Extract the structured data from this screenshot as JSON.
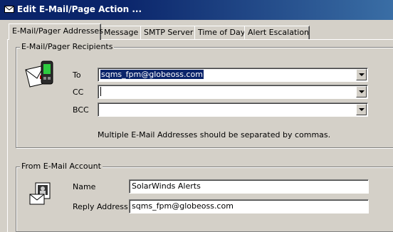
{
  "window": {
    "title": "Edit E-Mail/Page Action ...",
    "background_title": "...     ...     ...   ...     ...    ...     ..."
  },
  "tabs": [
    {
      "label": "E-Mail/Pager Addresses",
      "active": true
    },
    {
      "label": "Message",
      "active": false
    },
    {
      "label": "SMTP Server",
      "active": false
    },
    {
      "label": "Time of Day",
      "active": false
    },
    {
      "label": "Alert Escalation",
      "active": false
    }
  ],
  "recipients": {
    "group_label": "E-Mail/Pager Recipients",
    "to": {
      "label": "To",
      "value": "sqms_fpm@globeoss.com"
    },
    "cc": {
      "label": "CC",
      "value": ""
    },
    "bcc": {
      "label": "BCC",
      "value": ""
    },
    "hint": "Multiple E-Mail Addresses should be separated by commas."
  },
  "from_account": {
    "group_label": "From E-Mail Account",
    "name": {
      "label": "Name",
      "value": "SolarWinds Alerts"
    },
    "reply": {
      "label": "Reply Address",
      "value": "sqms_fpm@globeoss.com"
    }
  },
  "icons": {
    "title": "envelope-icon",
    "recipients": "pager-envelope-icon",
    "account": "address-card-icon"
  },
  "colors": {
    "titlebar": "#0a246a",
    "face": "#d4d0c8",
    "selection": "#0a246a"
  }
}
